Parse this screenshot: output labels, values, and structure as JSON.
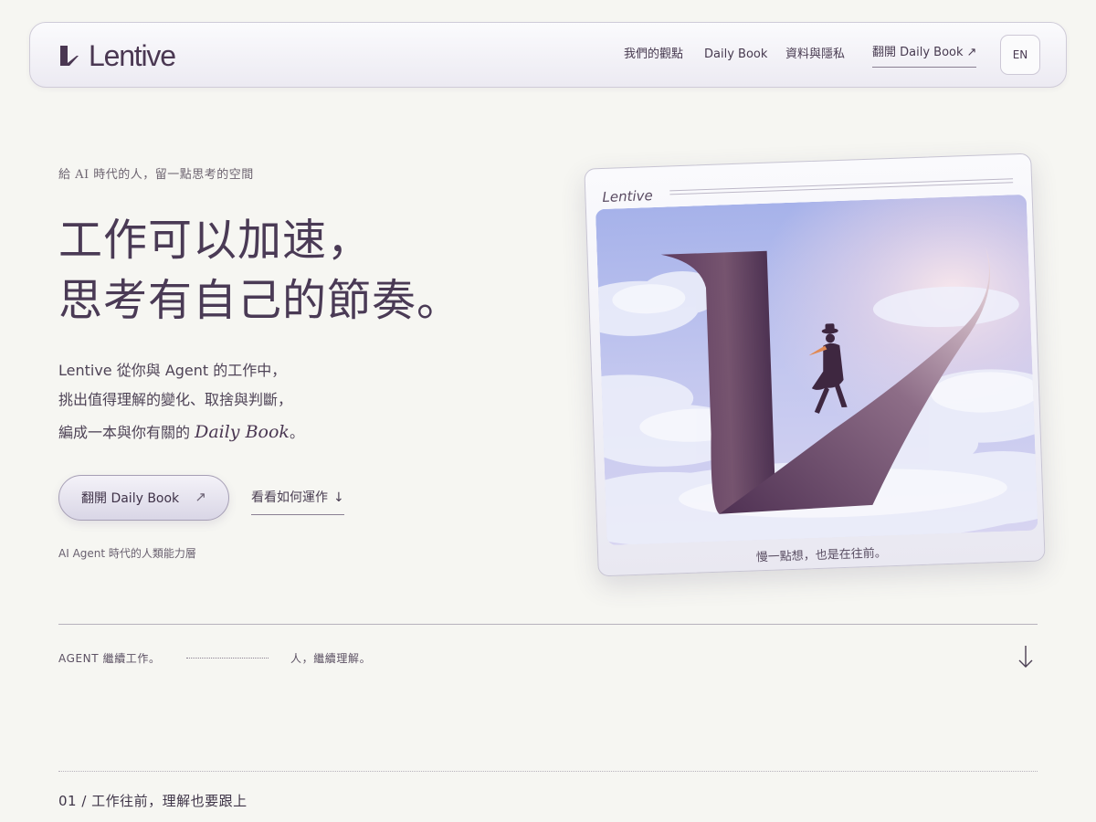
{
  "header": {
    "brand": "Lentive",
    "nav": {
      "observations": "我們的觀點",
      "daily_book": "Daily Book",
      "privacy": "資料與隱私",
      "open_book": "翻開 Daily Book",
      "open_book_arrow": "↗"
    },
    "language": "EN"
  },
  "hero": {
    "eyebrow": "給 AI 時代的人，留一點思考的空間",
    "headline": [
      "工作可以加速，",
      "思考有自己的節奏。"
    ],
    "intro": {
      "line1": "Lentive 從你與 Agent 的工作中，",
      "line2": "挑出值得理解的變化、取捨與判斷，",
      "line3_prefix": "編成一本與你有關的 ",
      "line3_book": "Daily Book",
      "line3_suffix": "。"
    },
    "cta_primary": {
      "label": "翻開 Daily Book",
      "icon": "↗"
    },
    "cta_secondary": {
      "label": "看看如何運作",
      "icon": "↓"
    },
    "caption": "AI Agent 時代的人類能力層"
  },
  "card": {
    "brand": "Lentive",
    "caption": "慢一點想，也是在往前。",
    "image_icon": "illustration-letter-l-path-sky"
  },
  "strip": {
    "agent": "AGENT 繼續工作。",
    "human": "人，繼續理解。",
    "scroll_icon": "arrow-down-icon"
  },
  "section": {
    "title": "01 / 工作往前，理解也要跟上"
  },
  "colors": {
    "background": "#f6f6f2",
    "ink": "#4a3a55",
    "accent_plum": "#5a3a5e",
    "sky_top": "#a8b4e8",
    "sky_glow": "#f1dde6"
  }
}
